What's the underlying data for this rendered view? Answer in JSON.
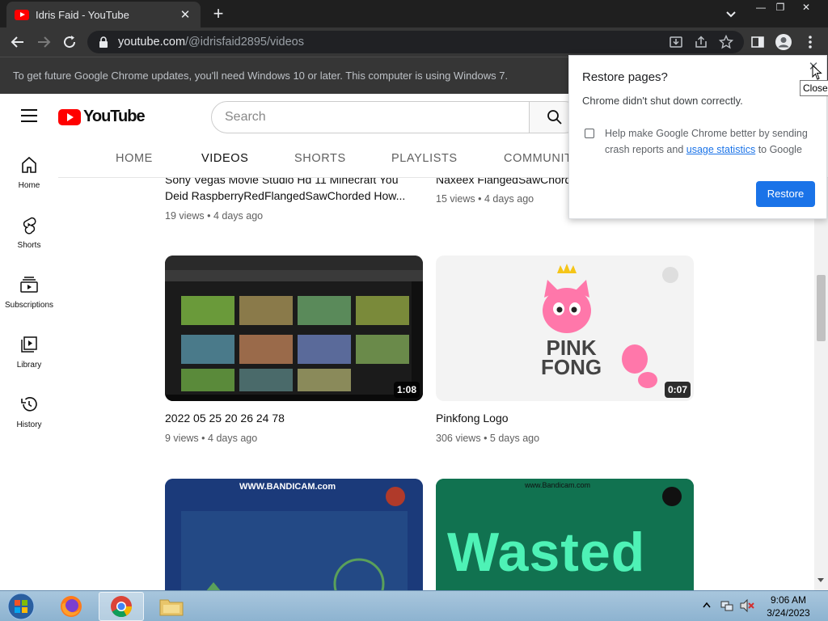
{
  "browser": {
    "tab_title": "Idris Faid - YouTube",
    "tab_close": "✕",
    "new_tab": "+",
    "url_host": "youtube.com",
    "url_path": "/@idrisfaid2895/videos",
    "win_min": "—",
    "win_restore": "❐",
    "win_close": "✕"
  },
  "infobar": {
    "message": "To get future Google Chrome updates, you'll need Windows 10 or later. This computer is using Windows 7."
  },
  "youtube": {
    "logo_text": "YouTube",
    "search_placeholder": "Search"
  },
  "channel_tabs": [
    "HOME",
    "VIDEOS",
    "SHORTS",
    "PLAYLISTS",
    "COMMUNITY"
  ],
  "guide": [
    {
      "label": "Home",
      "icon": "home-icon"
    },
    {
      "label": "Shorts",
      "icon": "shorts-icon"
    },
    {
      "label": "Subscriptions",
      "icon": "subscriptions-icon"
    },
    {
      "label": "Library",
      "icon": "library-icon"
    },
    {
      "label": "History",
      "icon": "history-icon"
    }
  ],
  "videos": [
    {
      "title_line1": "Sony Vegas Movie Studio Hd 11 Minecraft You",
      "title_line2": "Deid RaspberryRedFlangedSawChorded How...",
      "views": "19 views",
      "age": "4 days ago"
    },
    {
      "title_line1": "Naxeex FlangedSawChorded",
      "title_line2": "",
      "views": "15 views",
      "age": "4 days ago"
    },
    {
      "title_line1": "2022 05 25 20 26 24 78",
      "title_line2": "",
      "views": "9 views",
      "age": "4 days ago",
      "duration": "1:08"
    },
    {
      "title_line1": "Pinkfong Logo",
      "title_line2": "",
      "views": "306 views",
      "age": "5 days ago",
      "duration": "0:07",
      "thumb_text_1": "PINK",
      "thumb_text_2": "FONG"
    },
    {
      "thumb_text": "WWW.BANDICAM.com"
    },
    {
      "thumb_text": "Wasted",
      "thumb_small": "www.Bandicam.com"
    }
  ],
  "restore_popup": {
    "title": "Restore pages?",
    "body": "Chrome didn't shut down correctly.",
    "checkbox_text_before": "Help make Google Chrome better by sending crash reports and ",
    "checkbox_link": "usage statistics",
    "checkbox_text_after": " to Google",
    "restore_button": "Restore",
    "close_tooltip": "Close"
  },
  "taskbar": {
    "time": "9:06 AM",
    "date": "3/24/2023"
  },
  "colors": {
    "youtube_red": "#ff0000",
    "chrome_blue": "#1a73e8",
    "dark_toolbar": "#363636"
  }
}
